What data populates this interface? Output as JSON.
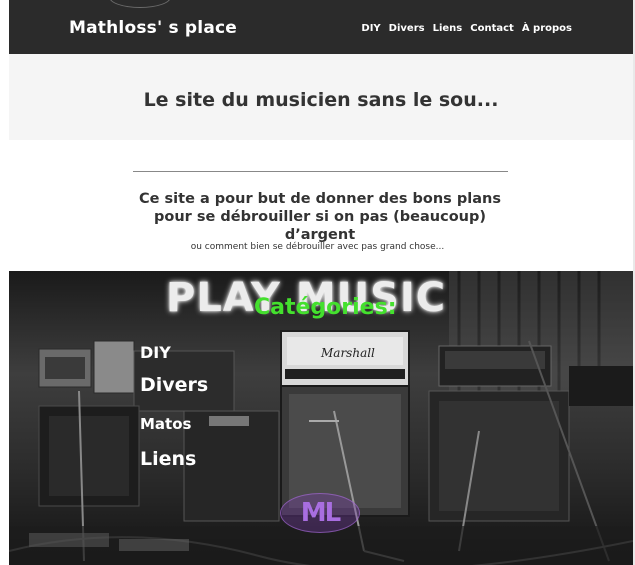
{
  "header": {
    "site_title": "Mathloss' s place",
    "nav": [
      "DIY",
      "Divers",
      "Liens",
      "Contact",
      "À propos"
    ]
  },
  "tagline": "Le site du musicien sans le sou...",
  "intro": {
    "title": "Ce site a pour but de donner des bons plans pour se débrouiller si on pas (beaucoup) d’argent",
    "subtitle": "ou comment bien se débrouiller avec pas grand chose..."
  },
  "hero": {
    "image_text": "PLAY MUSIC",
    "categories_heading": "Catégories:",
    "categories": [
      "DIY",
      "Divers",
      "Matos",
      "Liens"
    ],
    "logo_text": "ML",
    "amp_brand": "Marshall"
  },
  "colors": {
    "header_bg": "#2b2b2b",
    "tagline_bg": "#f5f5f5",
    "categories_heading": "#44e02e",
    "logo_purple": "#a86ee0"
  }
}
